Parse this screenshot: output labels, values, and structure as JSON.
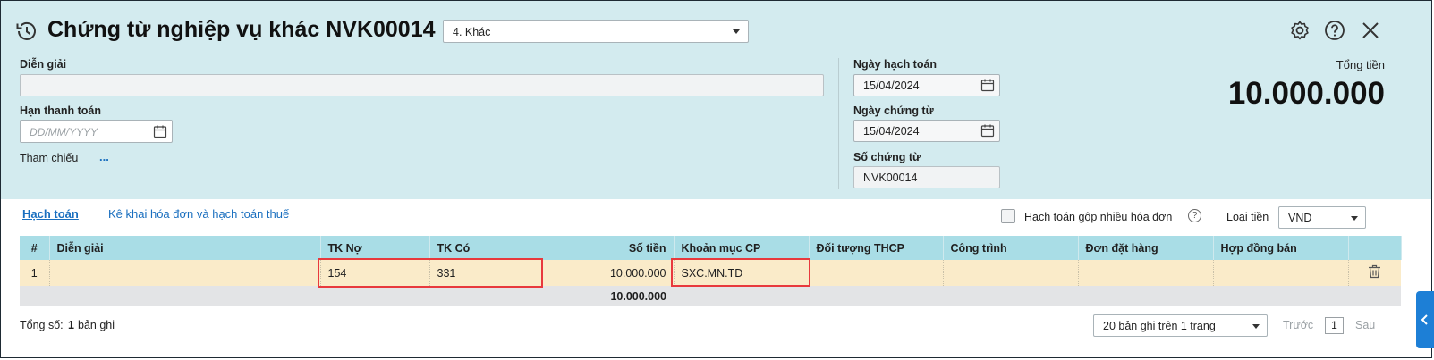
{
  "header": {
    "title": "Chứng từ nghiệp vụ khác NVK00014",
    "type_select": "4. Khác",
    "total_label": "Tổng tiền",
    "total_value": "10.000.000"
  },
  "form": {
    "description_label": "Diễn giải",
    "description_value": "",
    "due_date_label": "Hạn thanh toán",
    "due_date_placeholder": "DD/MM/YYYY",
    "reference_label": "Tham chiếu",
    "reference_more": "...",
    "posting_date_label": "Ngày hạch toán",
    "posting_date_value": "15/04/2024",
    "voucher_date_label": "Ngày chứng từ",
    "voucher_date_value": "15/04/2024",
    "voucher_no_label": "Số chứng từ",
    "voucher_no_value": "NVK00014"
  },
  "tabs": {
    "accounting": "Hạch toán",
    "invoice_tax": "Kê khai hóa đơn và hạch toán thuế"
  },
  "options": {
    "merge_invoices_label": "Hạch toán gộp nhiều hóa đơn",
    "help_glyph": "?",
    "currency_label": "Loại tiền",
    "currency_value": "VND"
  },
  "table": {
    "columns": [
      "#",
      "Diễn giải",
      "TK Nợ",
      "TK Có",
      "Số tiền",
      "Khoản mục CP",
      "Đối tượng THCP",
      "Công trình",
      "Đơn đặt hàng",
      "Hợp đồng bán"
    ],
    "rows": [
      {
        "no": "1",
        "desc": "",
        "debit": "154",
        "credit": "331",
        "amount": "10.000.000",
        "cost_item": "SXC.MN.TD",
        "cost_object": "",
        "project": "",
        "order": "",
        "contract": ""
      }
    ],
    "footer_amount": "10.000.000"
  },
  "pager": {
    "total_prefix": "Tổng số:",
    "total_count": "1",
    "total_suffix": "bản ghi",
    "page_size_select": "20 bản ghi trên 1 trang",
    "prev": "Trước",
    "page": "1",
    "next": "Sau"
  },
  "icons": {
    "history": "history-icon",
    "settings": "gear-icon",
    "help": "help-icon",
    "close": "close-icon",
    "calendar": "calendar-icon",
    "delete": "trash-icon",
    "collapse": "chevron-left-icon"
  },
  "colors": {
    "header_bg": "#d3ebef",
    "table_header_bg": "#a9dde6",
    "row_bg": "#faebc9",
    "highlight": "#e8393d",
    "link": "#1a6fbf"
  }
}
